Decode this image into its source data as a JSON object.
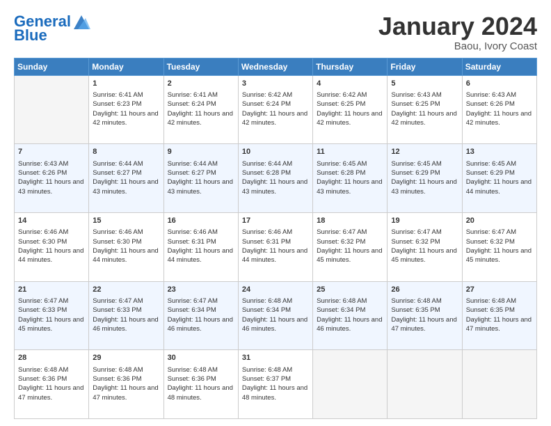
{
  "logo": {
    "line1": "General",
    "line2": "Blue"
  },
  "title": "January 2024",
  "subtitle": "Baou, Ivory Coast",
  "days": [
    "Sunday",
    "Monday",
    "Tuesday",
    "Wednesday",
    "Thursday",
    "Friday",
    "Saturday"
  ],
  "weeks": [
    [
      {
        "num": "",
        "sunrise": "",
        "sunset": "",
        "daylight": ""
      },
      {
        "num": "1",
        "sunrise": "Sunrise: 6:41 AM",
        "sunset": "Sunset: 6:23 PM",
        "daylight": "Daylight: 11 hours and 42 minutes."
      },
      {
        "num": "2",
        "sunrise": "Sunrise: 6:41 AM",
        "sunset": "Sunset: 6:24 PM",
        "daylight": "Daylight: 11 hours and 42 minutes."
      },
      {
        "num": "3",
        "sunrise": "Sunrise: 6:42 AM",
        "sunset": "Sunset: 6:24 PM",
        "daylight": "Daylight: 11 hours and 42 minutes."
      },
      {
        "num": "4",
        "sunrise": "Sunrise: 6:42 AM",
        "sunset": "Sunset: 6:25 PM",
        "daylight": "Daylight: 11 hours and 42 minutes."
      },
      {
        "num": "5",
        "sunrise": "Sunrise: 6:43 AM",
        "sunset": "Sunset: 6:25 PM",
        "daylight": "Daylight: 11 hours and 42 minutes."
      },
      {
        "num": "6",
        "sunrise": "Sunrise: 6:43 AM",
        "sunset": "Sunset: 6:26 PM",
        "daylight": "Daylight: 11 hours and 42 minutes."
      }
    ],
    [
      {
        "num": "7",
        "sunrise": "Sunrise: 6:43 AM",
        "sunset": "Sunset: 6:26 PM",
        "daylight": "Daylight: 11 hours and 43 minutes."
      },
      {
        "num": "8",
        "sunrise": "Sunrise: 6:44 AM",
        "sunset": "Sunset: 6:27 PM",
        "daylight": "Daylight: 11 hours and 43 minutes."
      },
      {
        "num": "9",
        "sunrise": "Sunrise: 6:44 AM",
        "sunset": "Sunset: 6:27 PM",
        "daylight": "Daylight: 11 hours and 43 minutes."
      },
      {
        "num": "10",
        "sunrise": "Sunrise: 6:44 AM",
        "sunset": "Sunset: 6:28 PM",
        "daylight": "Daylight: 11 hours and 43 minutes."
      },
      {
        "num": "11",
        "sunrise": "Sunrise: 6:45 AM",
        "sunset": "Sunset: 6:28 PM",
        "daylight": "Daylight: 11 hours and 43 minutes."
      },
      {
        "num": "12",
        "sunrise": "Sunrise: 6:45 AM",
        "sunset": "Sunset: 6:29 PM",
        "daylight": "Daylight: 11 hours and 43 minutes."
      },
      {
        "num": "13",
        "sunrise": "Sunrise: 6:45 AM",
        "sunset": "Sunset: 6:29 PM",
        "daylight": "Daylight: 11 hours and 44 minutes."
      }
    ],
    [
      {
        "num": "14",
        "sunrise": "Sunrise: 6:46 AM",
        "sunset": "Sunset: 6:30 PM",
        "daylight": "Daylight: 11 hours and 44 minutes."
      },
      {
        "num": "15",
        "sunrise": "Sunrise: 6:46 AM",
        "sunset": "Sunset: 6:30 PM",
        "daylight": "Daylight: 11 hours and 44 minutes."
      },
      {
        "num": "16",
        "sunrise": "Sunrise: 6:46 AM",
        "sunset": "Sunset: 6:31 PM",
        "daylight": "Daylight: 11 hours and 44 minutes."
      },
      {
        "num": "17",
        "sunrise": "Sunrise: 6:46 AM",
        "sunset": "Sunset: 6:31 PM",
        "daylight": "Daylight: 11 hours and 44 minutes."
      },
      {
        "num": "18",
        "sunrise": "Sunrise: 6:47 AM",
        "sunset": "Sunset: 6:32 PM",
        "daylight": "Daylight: 11 hours and 45 minutes."
      },
      {
        "num": "19",
        "sunrise": "Sunrise: 6:47 AM",
        "sunset": "Sunset: 6:32 PM",
        "daylight": "Daylight: 11 hours and 45 minutes."
      },
      {
        "num": "20",
        "sunrise": "Sunrise: 6:47 AM",
        "sunset": "Sunset: 6:32 PM",
        "daylight": "Daylight: 11 hours and 45 minutes."
      }
    ],
    [
      {
        "num": "21",
        "sunrise": "Sunrise: 6:47 AM",
        "sunset": "Sunset: 6:33 PM",
        "daylight": "Daylight: 11 hours and 45 minutes."
      },
      {
        "num": "22",
        "sunrise": "Sunrise: 6:47 AM",
        "sunset": "Sunset: 6:33 PM",
        "daylight": "Daylight: 11 hours and 46 minutes."
      },
      {
        "num": "23",
        "sunrise": "Sunrise: 6:47 AM",
        "sunset": "Sunset: 6:34 PM",
        "daylight": "Daylight: 11 hours and 46 minutes."
      },
      {
        "num": "24",
        "sunrise": "Sunrise: 6:48 AM",
        "sunset": "Sunset: 6:34 PM",
        "daylight": "Daylight: 11 hours and 46 minutes."
      },
      {
        "num": "25",
        "sunrise": "Sunrise: 6:48 AM",
        "sunset": "Sunset: 6:34 PM",
        "daylight": "Daylight: 11 hours and 46 minutes."
      },
      {
        "num": "26",
        "sunrise": "Sunrise: 6:48 AM",
        "sunset": "Sunset: 6:35 PM",
        "daylight": "Daylight: 11 hours and 47 minutes."
      },
      {
        "num": "27",
        "sunrise": "Sunrise: 6:48 AM",
        "sunset": "Sunset: 6:35 PM",
        "daylight": "Daylight: 11 hours and 47 minutes."
      }
    ],
    [
      {
        "num": "28",
        "sunrise": "Sunrise: 6:48 AM",
        "sunset": "Sunset: 6:36 PM",
        "daylight": "Daylight: 11 hours and 47 minutes."
      },
      {
        "num": "29",
        "sunrise": "Sunrise: 6:48 AM",
        "sunset": "Sunset: 6:36 PM",
        "daylight": "Daylight: 11 hours and 47 minutes."
      },
      {
        "num": "30",
        "sunrise": "Sunrise: 6:48 AM",
        "sunset": "Sunset: 6:36 PM",
        "daylight": "Daylight: 11 hours and 48 minutes."
      },
      {
        "num": "31",
        "sunrise": "Sunrise: 6:48 AM",
        "sunset": "Sunset: 6:37 PM",
        "daylight": "Daylight: 11 hours and 48 minutes."
      },
      {
        "num": "",
        "sunrise": "",
        "sunset": "",
        "daylight": ""
      },
      {
        "num": "",
        "sunrise": "",
        "sunset": "",
        "daylight": ""
      },
      {
        "num": "",
        "sunrise": "",
        "sunset": "",
        "daylight": ""
      }
    ]
  ]
}
